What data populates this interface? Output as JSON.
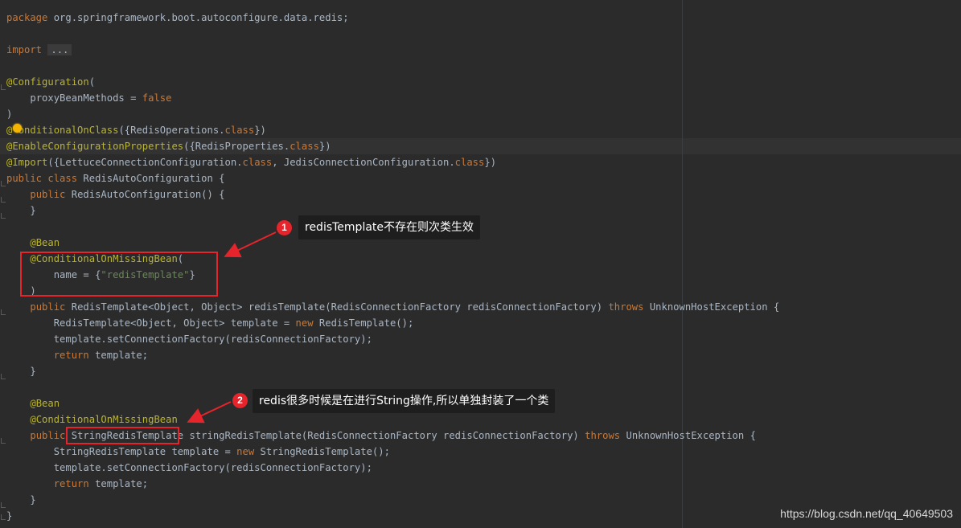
{
  "code": {
    "package_kw": "package",
    "package_name": " org.springframework.boot.autoconfigure.data.redis;",
    "import_kw": "import",
    "import_fold": "...",
    "ann_configuration": "@Configuration",
    "paren_open": "(",
    "indent4": "    ",
    "indent8": "        ",
    "proxy_prefix": "proxyBeanMethods = ",
    "false_kw": "false",
    "paren_close": ")",
    "ann_cond_on_class_a": "@",
    "ann_cond_on_class_b": "onditionalOnClass",
    "cond_on_class_rest": "({RedisOperations.",
    "class_kw": "class",
    "brace_paren_close": "})",
    "ann_enable_props": "@EnableConfigurationProperties",
    "enable_props_rest_a": "({RedisPr",
    "enable_props_rest_b": "operties.",
    "ann_import": "@Import",
    "import_rest_a": "({LettuceConnectionConfiguration.",
    "import_rest_b": ", JedisConnectionConfiguration.",
    "public_kw": "public",
    "class_decl_rest": " RedisAutoConfiguration {",
    "ctor_rest": " RedisAutoConfiguration() {",
    "close_brace": "}",
    "ann_bean": "@Bean",
    "ann_missing_bean": "@ConditionalOnMissingBean",
    "name_prefix": "name = {",
    "redis_template_str": "\"redisTemplate\"",
    "brace_close_only": "}",
    "method1_sig_a": " RedisTemplate<Object, Object> redisTemplate(RedisConnectionFactory redisConnectionFactory) ",
    "throws_kw": "throws",
    "method1_sig_b": " UnknownHostException {",
    "m1_line1_a": "RedisTemplate<Object, Object> template = ",
    "new_kw": "new",
    "m1_line1_b": " RedisTemplate();",
    "set_factory_line": "template.setConnectionFactory(redisConnectionFactory);",
    "return_kw": "return",
    "return_rest": " template;",
    "method2_type": "StringRedisTemplate",
    "method2_sig_a": " stringRedisTemplate(RedisConnectionFactory redisConnectionFactory) ",
    "m2_line1_a": "StringRedisTemplate template = ",
    "m2_line1_b": " StringRedisTemplate();"
  },
  "callouts": [
    {
      "number": "1",
      "text": "redisTemplate不存在则次类生效"
    },
    {
      "number": "2",
      "text": "redis很多时候是在进行String操作,所以单独封装了一个类"
    }
  ],
  "watermark": "https://blog.csdn.net/qq_40649503",
  "colors": {
    "background": "#2b2b2b",
    "keyword": "#cc7832",
    "annotation": "#bbb529",
    "string": "#6a8759",
    "default_text": "#a9b7c6",
    "highlight_red": "#e5242b"
  }
}
